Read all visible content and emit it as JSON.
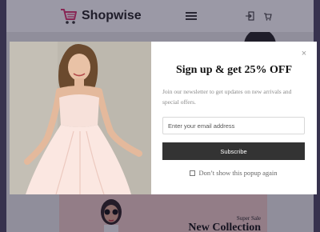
{
  "header": {
    "logo_text": "Shopwise",
    "icons": [
      "cart-logo-icon",
      "hamburger-menu-icon",
      "login-icon",
      "shopping-bag-icon"
    ]
  },
  "banner": {
    "super_sale": "Super Sale",
    "new_collection": "New Collection"
  },
  "popup": {
    "title": "Sign up & get 25% OFF",
    "description": "Join our newsletter to get updates on new arrivals and special offers.",
    "email_placeholder": "Enter your email address",
    "email_value": "",
    "subscribe_label": "Subscribe",
    "dont_show_label": "Don’t show this popup again",
    "dont_show_checked": false,
    "close_symbol": "×"
  },
  "colors": {
    "overlay": "#1c1836",
    "button_bg": "#333333",
    "logo_accent": "#d6336c",
    "banner_bg": "#e8c7c2"
  }
}
